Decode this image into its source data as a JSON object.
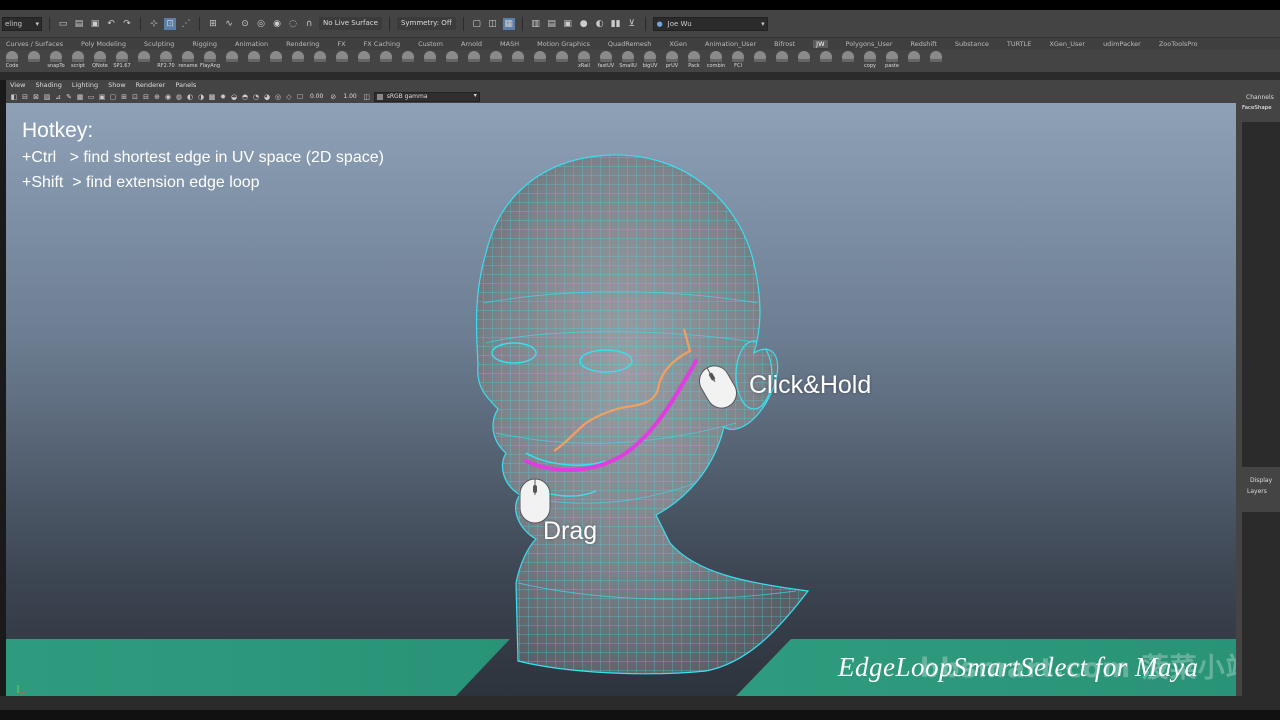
{
  "statusline": {
    "mode": "eling",
    "live_surface": "No Live Surface",
    "symmetry": "Symmetry: Off",
    "user": "Joe Wu"
  },
  "shelf_tabs": [
    "Curves / Surfaces",
    "Poly Modeling",
    "Sculpting",
    "Rigging",
    "Animation",
    "Rendering",
    "FX",
    "FX Caching",
    "Custom",
    "Arnold",
    "MASH",
    "Motion Graphics",
    "QuadRemesh",
    "XGen",
    "Animation_User",
    "Bifrost",
    "JW",
    "Polygons_User",
    "Redshift",
    "Substance",
    "TURTLE",
    "XGen_User",
    "udimPacker",
    "ZooToolsPro"
  ],
  "active_shelf_tab": "JW",
  "shelf_buttons": [
    "Code",
    "",
    "snapTo",
    "script",
    "QNote",
    "SP1.67",
    "",
    "RF2.70",
    "rename",
    "FlayAng",
    "",
    "",
    "",
    "",
    "",
    "",
    "",
    "",
    "",
    "",
    "",
    "",
    "",
    "",
    "",
    "",
    "zRail",
    "fastUV",
    "SmallU",
    "bigUV",
    "prUV",
    "Pack",
    "combin",
    "FCI",
    "",
    "",
    "",
    "",
    "",
    "copy",
    "paste",
    "",
    ""
  ],
  "panel_menu": [
    "View",
    "Shading",
    "Lighting",
    "Show",
    "Renderer",
    "Panels"
  ],
  "panel_toolbar": {
    "value_a": "0.00",
    "value_b": "1.00",
    "color_space": "sRGB gamma"
  },
  "viewport": {
    "camera": "persp",
    "overlay": {
      "title": "Hotkey:",
      "lines": [
        "+Ctrl   > find shortest edge in UV space (2D space)",
        "+Shift  > find extension edge loop"
      ],
      "click_label": "Click&Hold",
      "drag_label": "Drag"
    },
    "banner_text": "EdgeLoopSmartSelect for Maya",
    "watermark": "bbsmart.com 菠菜小站",
    "colors": {
      "wire": "#38e0f0",
      "path_magenta": "#e03ce0",
      "path_orange": "#f0a060",
      "banner": "#2d9a7c"
    }
  },
  "right_panel": {
    "title": "Channels",
    "subtitle": "FaceShape",
    "display": "Display",
    "layers": "Layers"
  }
}
